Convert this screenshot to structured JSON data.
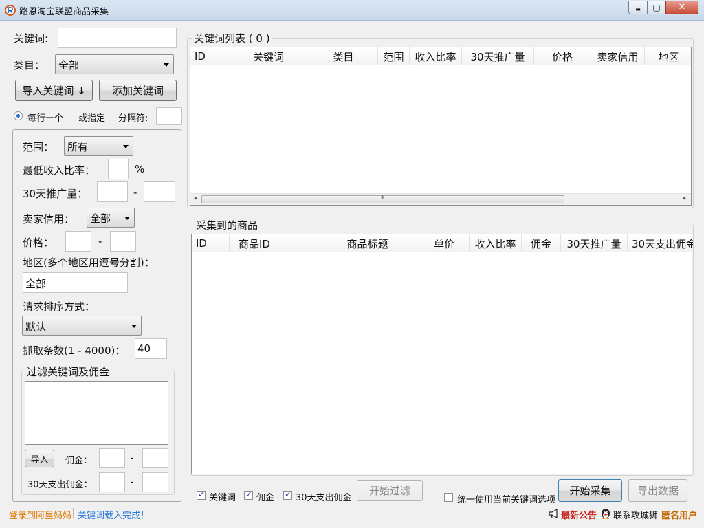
{
  "window": {
    "title": "路恩淘宝联盟商品采集",
    "controls": {
      "minimize": "▬",
      "maximize": "▢",
      "close": "✕"
    }
  },
  "left": {
    "keyword_label": "关键词:",
    "keyword_value": "",
    "category_label": "类目：",
    "category_value": "全部",
    "import_keyword_button": "导入关键词 ↓",
    "add_keyword_button": "添加关键词",
    "split_mode": {
      "per_line_label": "每行一个",
      "or_specified_label": "或指定",
      "separator_label": "分隔符:",
      "separator_value": ""
    },
    "filters": {
      "range_label": "范围：",
      "range_value": "所有",
      "min_income_label": "最低收入比率：",
      "min_income_value": "",
      "percent": "%",
      "promo30_label": "30天推广量：",
      "promo30_min": "",
      "promo30_max": "",
      "dash": "-",
      "credit_label": "卖家信用：",
      "credit_value": "全部",
      "price_label": "价格：",
      "price_min": "",
      "price_max": "",
      "region_label": "地区(多个地区用逗号分割)：",
      "region_value": "全部",
      "sort_label": "请求排序方式：",
      "sort_value": "默认",
      "fetch_label": "抓取条数(1 - 4000)：",
      "fetch_value": "40"
    },
    "filter_box": {
      "title": "过滤关键词及佣金",
      "import_button": "导入",
      "commission_label": "佣金：",
      "commission_min": "",
      "commission_max": "",
      "spend30_label": "30天支出佣金：",
      "spend30_min": "",
      "spend30_max": ""
    }
  },
  "keyword_list": {
    "title": "关键词列表 ( 0 )",
    "columns": [
      "ID",
      "关键词",
      "类目",
      "范围",
      "收入比率",
      "30天推广量",
      "价格",
      "卖家信用",
      "地区"
    ],
    "scroll_grip": "III"
  },
  "products": {
    "title": "采集到的商品",
    "columns": [
      "ID",
      "商品ID",
      "商品标题",
      "单价",
      "收入比率",
      "佣金",
      "30天推广量",
      "30天支出佣金"
    ]
  },
  "bottom": {
    "check_keyword": "关键词",
    "check_commission": "佣金",
    "check_spend30": "30天支出佣金",
    "start_filter_button": "开始过滤",
    "use_current_label": "统一使用当前关键词选项",
    "start_collect_button": "开始采集",
    "export_button": "导出数据"
  },
  "status": {
    "login_link": "登录到阿里妈妈",
    "status_text": "关键词载入完成！",
    "announcement": "最新公告",
    "contact": "联系攻城狮",
    "user": "匿名用户"
  },
  "colors": {
    "login": "#e07b00",
    "status": "#2a7ad8",
    "announcement": "#c8281e",
    "user": "#c56a00"
  }
}
